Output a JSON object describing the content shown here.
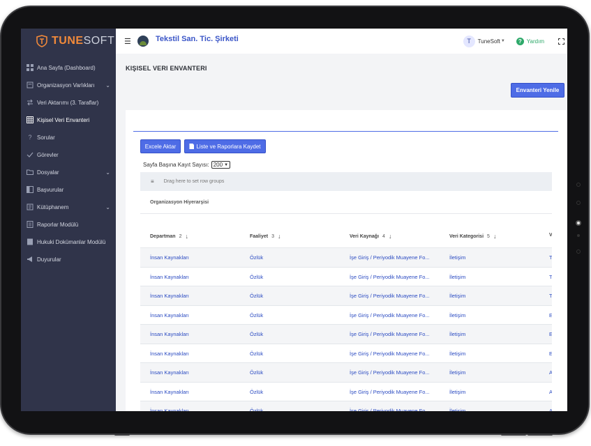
{
  "brand": {
    "name_part1": "TUNE",
    "name_part2": "SOFT"
  },
  "sidebar": {
    "items": [
      {
        "label": "Ana Sayfa (Dashboard)",
        "icon": "dashboard-icon",
        "chevron": false
      },
      {
        "label": "Organizasyon Varlıkları",
        "icon": "building-icon",
        "chevron": true
      },
      {
        "label": "Veri Aktarımı (3. Taraflar)",
        "icon": "transfer-icon",
        "chevron": false
      },
      {
        "label": "Kişisel Veri Envanteri",
        "icon": "table-icon",
        "chevron": false,
        "active": true
      },
      {
        "label": "Sorular",
        "icon": "question-icon",
        "chevron": false
      },
      {
        "label": "Görevler",
        "icon": "task-icon",
        "chevron": false
      },
      {
        "label": "Dosyalar",
        "icon": "folder-icon",
        "chevron": true
      },
      {
        "label": "Başvurular",
        "icon": "application-icon",
        "chevron": false
      },
      {
        "label": "Kütüphanem",
        "icon": "library-icon",
        "chevron": true
      },
      {
        "label": "Raporlar Modülü",
        "icon": "report-icon",
        "chevron": false
      },
      {
        "label": "Hukuki Dokümanlar Modülü",
        "icon": "legal-icon",
        "chevron": false
      },
      {
        "label": "Duyurular",
        "icon": "megaphone-icon",
        "chevron": false
      }
    ]
  },
  "header": {
    "company": "Tekstil San. Tic. Şirketi",
    "user_initial": "T",
    "user_name": "TuneSoft",
    "help_label": "Yardım"
  },
  "page": {
    "title": "KIŞISEL VERI ENVANTERI",
    "refresh_button": "Envanteri Yenile",
    "excel_button": "Excele Aktar",
    "save_button": "Liste ve Raporlara Kaydet",
    "page_size_label": "Sayfa Başına Kayıt Sayısı:",
    "page_size_value": "200",
    "group_panel_text": "Drag here to set row groups",
    "org_hierarchy_label": "Organizasyon Hiyerarşisi"
  },
  "grid": {
    "columns": [
      {
        "label": "Departman",
        "order": "2"
      },
      {
        "label": "Faaliyet",
        "order": "3"
      },
      {
        "label": "Veri Kaynağı",
        "order": "4"
      },
      {
        "label": "Veri Kategorisi",
        "order": "5"
      },
      {
        "label": "V",
        "order": ""
      }
    ],
    "rows": [
      [
        "İnsan Kaynakları",
        "Özlük",
        "İşe Giriş / Periyodik Muayene Fo...",
        "İletişim",
        "T"
      ],
      [
        "İnsan Kaynakları",
        "Özlük",
        "İşe Giriş / Periyodik Muayene Fo...",
        "İletişim",
        "T"
      ],
      [
        "İnsan Kaynakları",
        "Özlük",
        "İşe Giriş / Periyodik Muayene Fo...",
        "İletişim",
        "T"
      ],
      [
        "İnsan Kaynakları",
        "Özlük",
        "İşe Giriş / Periyodik Muayene Fo...",
        "İletişim",
        "E"
      ],
      [
        "İnsan Kaynakları",
        "Özlük",
        "İşe Giriş / Periyodik Muayene Fo...",
        "İletişim",
        "E"
      ],
      [
        "İnsan Kaynakları",
        "Özlük",
        "İşe Giriş / Periyodik Muayene Fo...",
        "İletişim",
        "E"
      ],
      [
        "İnsan Kaynakları",
        "Özlük",
        "İşe Giriş / Periyodik Muayene Fo...",
        "İletişim",
        "A"
      ],
      [
        "İnsan Kaynakları",
        "Özlük",
        "İşe Giriş / Periyodik Muayene Fo...",
        "İletişim",
        "A"
      ],
      [
        "İnsan Kaynakları",
        "Özlük",
        "İşe Giriş / Periyodik Muayene Fo...",
        "İletişim",
        "A"
      ]
    ]
  },
  "colors": {
    "sidebar_bg": "#30344a",
    "accent": "#4e6ce6",
    "brand_orange": "#f28a3a",
    "link": "#2b4bc2",
    "help_green": "#2ea96a"
  }
}
